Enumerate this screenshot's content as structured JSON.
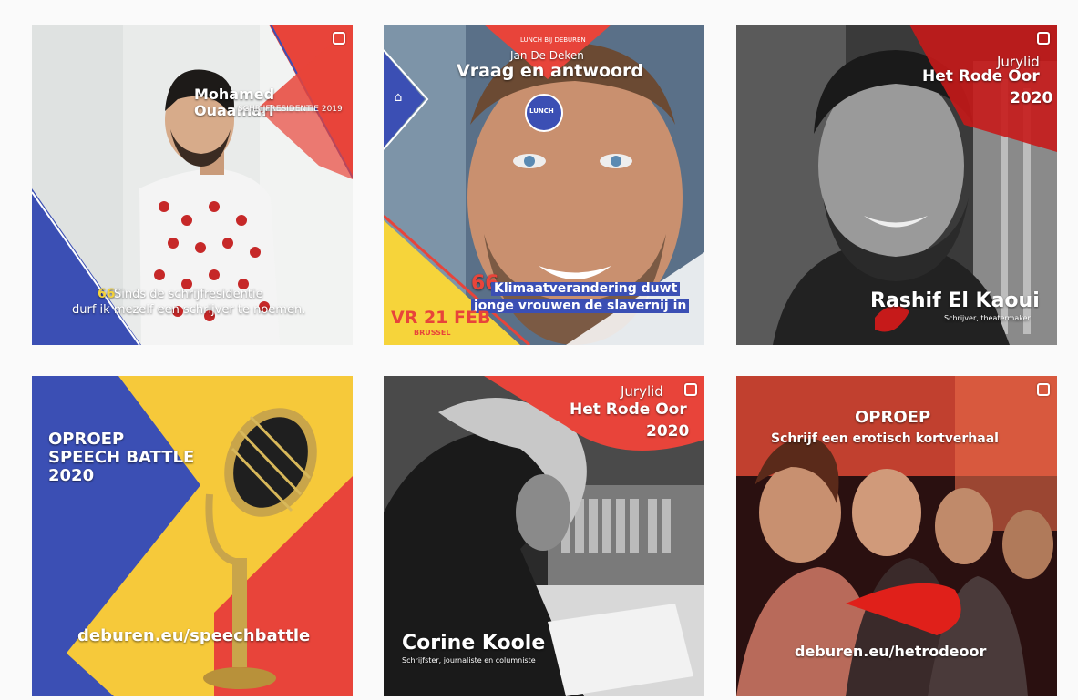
{
  "posts": [
    {
      "name": "Mohamed Ouaamari",
      "subtitle": "SCHRIJFRESIDENTIE 2019",
      "quote_line1": "Sinds de schrijfresidentie",
      "quote_line2": "durf ik mezelf een schrijver te noemen.",
      "quote_mark": "66"
    },
    {
      "kicker": "LUNCH BIJ DEBUREN",
      "name": "Jan De Deken",
      "title": "Vraag en antwoord",
      "badge": "LUNCH",
      "quote_mark": "66",
      "quote_line1": "Klimaatverandering duwt",
      "quote_line2": "jonge vrouwen de slavernij in",
      "date": "VR 21 FEB",
      "city": "BRUSSEL"
    },
    {
      "role": "Jurylid",
      "prize": "Het Rode Oor",
      "year": "2020",
      "name": "Rashif El Kaoui",
      "subtitle": "Schrijver, theatermaker"
    },
    {
      "line1": "OPROEP",
      "line2": "SPEECH BATTLE",
      "line3": "2020",
      "url": "deburen.eu/speechbattle"
    },
    {
      "role": "Jurylid",
      "prize": "Het Rode Oor",
      "year": "2020",
      "name": "Corine Koole",
      "subtitle": "Schrijfster, journaliste en columniste"
    },
    {
      "title": "OPROEP",
      "subtitle": "Schrijf een erotisch kortverhaal",
      "url": "deburen.eu/hetrodeoor"
    }
  ],
  "colors": {
    "red": "#e8443a",
    "blue": "#3b4fb4",
    "yellow": "#f6d43a",
    "darkred": "#c61a1a"
  },
  "icons": {
    "multi": "carousel-icon",
    "building": "building-icon",
    "ear": "ear-logo-icon"
  }
}
